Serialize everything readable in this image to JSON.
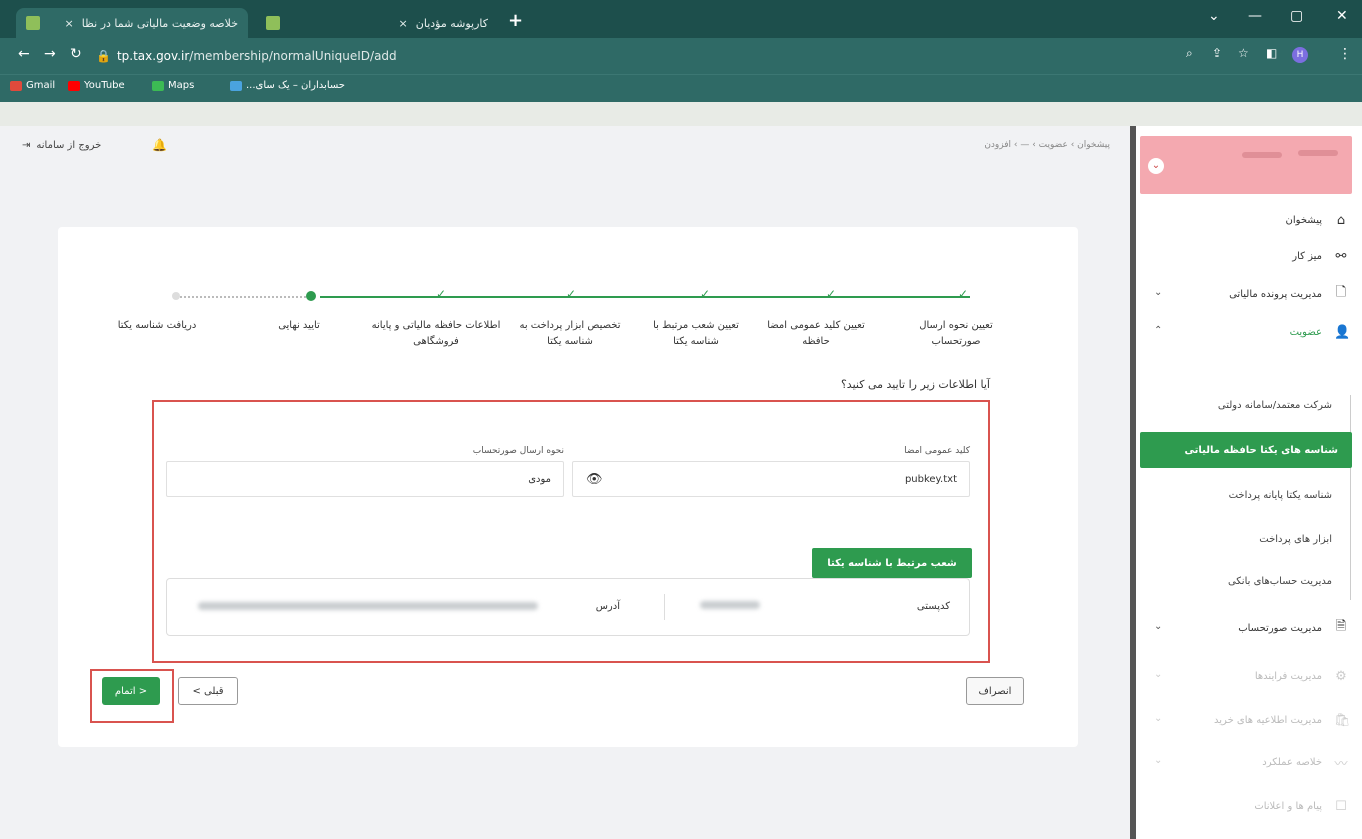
{
  "browser": {
    "tabs": [
      {
        "title": "خلاصه وضعیت مالیاتی شما در نظا",
        "close": "×"
      },
      {
        "title": "کارپوشه مؤدیان",
        "close": "×"
      }
    ],
    "new_tab": "+",
    "window_controls": [
      "⌄",
      "—",
      "▢",
      "✕"
    ],
    "url_domain": "tp.tax.gov.ir",
    "url_path": "/membership/normalUniqueID/add",
    "bookmarks": [
      "Gmail",
      "YouTube",
      "Maps",
      "حسابداران – یک سای..."
    ]
  },
  "header": {
    "logout_label": "خروج از سامانه",
    "breadcrumb": "پیشخوان  ›  عضویت  ›  —  ›  افزودن"
  },
  "sidebar": {
    "items": [
      {
        "label": "پیشخوان",
        "icon": "home-icon"
      },
      {
        "label": "میز کار",
        "icon": "workspace-icon"
      },
      {
        "label": "مدیریت پرونده مالیاتی",
        "icon": "file-icon"
      },
      {
        "label": "عضویت",
        "icon": "user-icon"
      },
      {
        "label": "مدیریت صورتحساب",
        "icon": "invoice-icon"
      },
      {
        "label": "مدیریت فرایندها",
        "icon": "process-icon"
      },
      {
        "label": "مدیریت اطلاعیه های خرید",
        "icon": "bag-icon"
      },
      {
        "label": "خلاصه عملکرد",
        "icon": "chart-icon"
      },
      {
        "label": "پیام ها و اعلانات",
        "icon": "message-icon"
      }
    ],
    "membership_subitems": [
      "شرکت معتمد/سامانه دولتی",
      "شناسه های یکتا حافظه مالیاتی",
      "شناسه یکتا پایانه پرداخت",
      "ابزار های پرداخت",
      "مدیریت حساب‌های بانکی"
    ]
  },
  "wizard": {
    "steps": [
      "تعیین نحوه ارسال صورتحساب",
      "تعیین کلید عمومی امضا حافظه",
      "تعیین شعب مرتبط با شناسه یکتا",
      "تخصیص ابزار پرداخت به شناسه یکتا",
      "اطلاعات حافظه مالیاتی و پایانه فروشگاهی",
      "تایید نهایی",
      "دریافت شناسه یکتا"
    ],
    "question": "آیا اطلاعات زیر را تایید می کنید؟",
    "public_key_label": "کلید عمومی امضا",
    "public_key_value": "pubkey.txt",
    "send_method_label": "نحوه ارسال صورتحساب",
    "send_method_value": "مودی",
    "branches_button": "شعب مرتبط با شناسه یکتا",
    "postal_code_label": "کدپستی",
    "address_label": "آدرس",
    "cancel_button": "انصراف",
    "prev_button": "< قبلی",
    "finish_button": "اتمام >"
  }
}
